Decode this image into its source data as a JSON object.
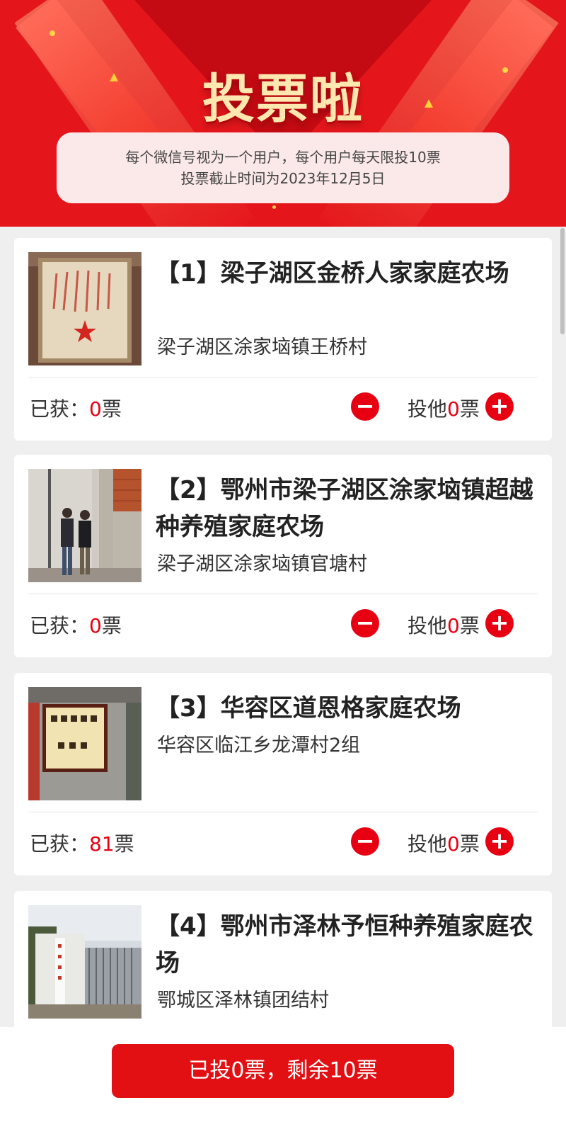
{
  "header": {
    "title": "投票啦",
    "notice_line1": "每个微信号视为一个用户，每个用户每天限投10票",
    "notice_line2": "投票截止时间为2023年12月5日"
  },
  "labels": {
    "got_prefix": "已获：",
    "vote_prefix": "投他",
    "unit": "票",
    "minus": "−",
    "plus": "+"
  },
  "items": [
    {
      "name": "【1】梁子湖区金桥人家家庭农场",
      "address": "梁子湖区涂家垴镇王桥村",
      "votes": "0",
      "my_votes": "0"
    },
    {
      "name": "【2】鄂州市梁子湖区涂家垴镇超越种养殖家庭农场",
      "address": "梁子湖区涂家垴镇官塘村",
      "votes": "0",
      "my_votes": "0"
    },
    {
      "name": "【3】华容区道恩格家庭农场",
      "address": "华容区临江乡龙潭村2组",
      "votes": "81",
      "my_votes": "0"
    },
    {
      "name": "【4】鄂州市泽林予恒种养殖家庭农场",
      "address": "鄂城区泽林镇团结村"
    }
  ],
  "footer": {
    "submit_label": "已投0票，剩余10票"
  },
  "colors": {
    "brand_red": "#e60012",
    "banner_red": "#e4161b"
  }
}
